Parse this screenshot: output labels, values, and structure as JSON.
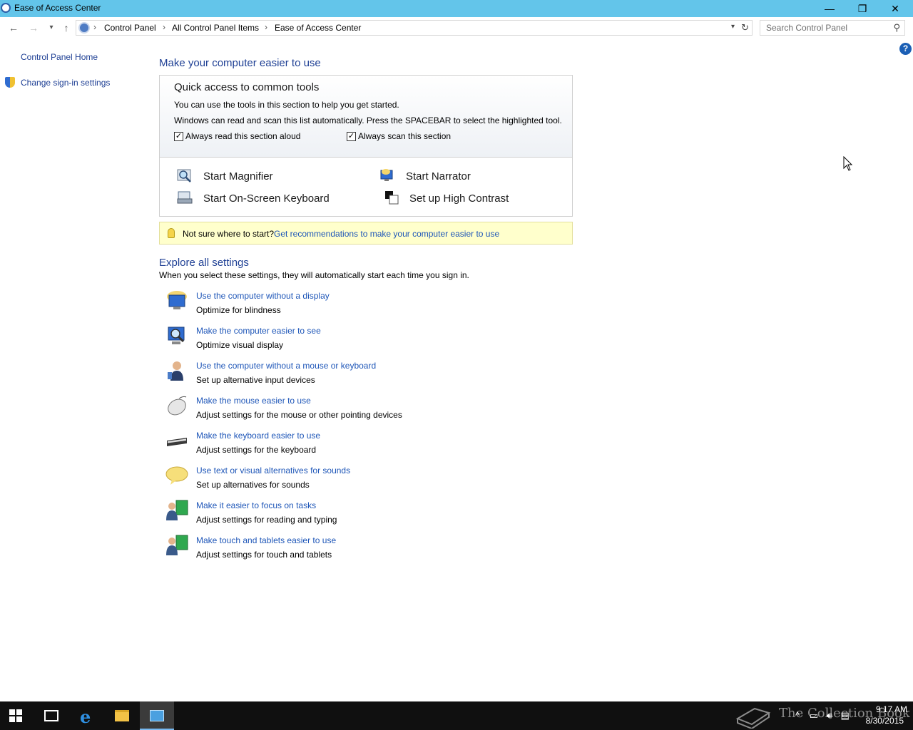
{
  "window": {
    "title": "Ease of Access Center",
    "controls": {
      "minimize": "—",
      "maximize": "❐",
      "close": "✕"
    }
  },
  "nav": {
    "breadcrumbs": [
      "Control Panel",
      "All Control Panel Items",
      "Ease of Access Center"
    ],
    "search_placeholder": "Search Control Panel"
  },
  "sidebar": {
    "home": "Control Panel Home",
    "signin": "Change sign-in settings"
  },
  "main": {
    "title": "Make your computer easier to use",
    "quick": {
      "heading": "Quick access to common tools",
      "desc1": "You can use the tools in this section to help you get started.",
      "desc2": "Windows can read and scan this list automatically.  Press the SPACEBAR to select the highlighted tool.",
      "read_aloud": {
        "label": "Always read this section aloud",
        "checked": true
      },
      "scan": {
        "label": "Always scan this section",
        "checked": true
      },
      "tools": [
        {
          "label": "Start Magnifier",
          "icon": "magnifier-icon"
        },
        {
          "label": "Start Narrator",
          "icon": "narrator-icon"
        },
        {
          "label": "Start On-Screen Keyboard",
          "icon": "keyboard-icon"
        },
        {
          "label": "Set up High Contrast",
          "icon": "high-contrast-icon"
        }
      ]
    },
    "tip": {
      "text": "Not sure where to start?",
      "link": "Get recommendations to make your computer easier to use"
    },
    "explore": {
      "title": "Explore all settings",
      "desc": "When you select these settings, they will automatically start each time you sign in.",
      "items": [
        {
          "link": "Use the computer without a display",
          "sub": "Optimize for blindness",
          "icon": "monitor-speaker-icon"
        },
        {
          "link": "Make the computer easier to see",
          "sub": "Optimize visual display",
          "icon": "monitor-magnifier-icon"
        },
        {
          "link": "Use the computer without a mouse or keyboard",
          "sub": "Set up alternative input devices",
          "icon": "person-icon"
        },
        {
          "link": "Make the mouse easier to use",
          "sub": "Adjust settings for the mouse or other pointing devices",
          "icon": "mouse-icon"
        },
        {
          "link": "Make the keyboard easier to use",
          "sub": "Adjust settings for the keyboard",
          "icon": "keyboard-icon"
        },
        {
          "link": "Use text or visual alternatives for sounds",
          "sub": "Set up alternatives for sounds",
          "icon": "speech-bubble-icon"
        },
        {
          "link": "Make it easier to focus on tasks",
          "sub": "Adjust settings for reading and typing",
          "icon": "users-focus-icon"
        },
        {
          "link": "Make touch and tablets easier to use",
          "sub": "Adjust settings for touch and tablets",
          "icon": "users-touch-icon"
        }
      ]
    }
  },
  "taskbar": {
    "watermark": "The Collection Book",
    "time": "9:17 AM",
    "date": "8/30/2015"
  },
  "colors": {
    "titlebar": "#63c5ea",
    "link": "#1e56b8",
    "heading": "#1e3f94",
    "tip_bg": "#ffffcc",
    "taskbar": "#101010"
  }
}
